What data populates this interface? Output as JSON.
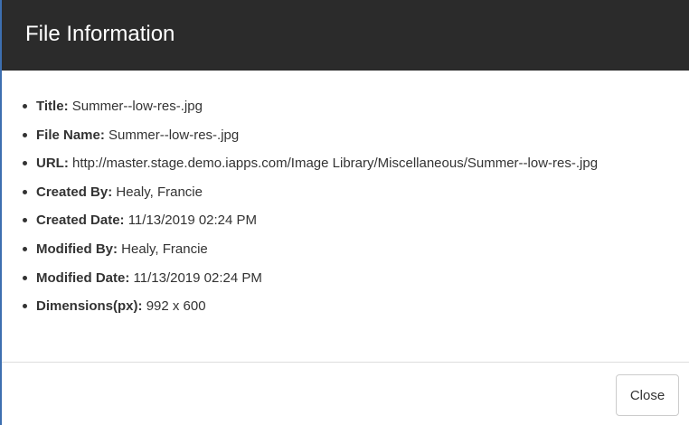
{
  "dialog": {
    "title": "File Information",
    "close_label": "Close"
  },
  "fields": [
    {
      "label": "Title:",
      "value": "Summer--low-res-.jpg"
    },
    {
      "label": "File Name:",
      "value": "Summer--low-res-.jpg"
    },
    {
      "label": "URL:",
      "value": "http://master.stage.demo.iapps.com/Image Library/Miscellaneous/Summer--low-res-.jpg"
    },
    {
      "label": "Created By:",
      "value": "Healy, Francie"
    },
    {
      "label": "Created Date:",
      "value": "11/13/2019 02:24 PM"
    },
    {
      "label": "Modified By:",
      "value": "Healy, Francie"
    },
    {
      "label": "Modified Date:",
      "value": "11/13/2019 02:24 PM"
    },
    {
      "label": "Dimensions(px):",
      "value": "992 x 600"
    }
  ]
}
